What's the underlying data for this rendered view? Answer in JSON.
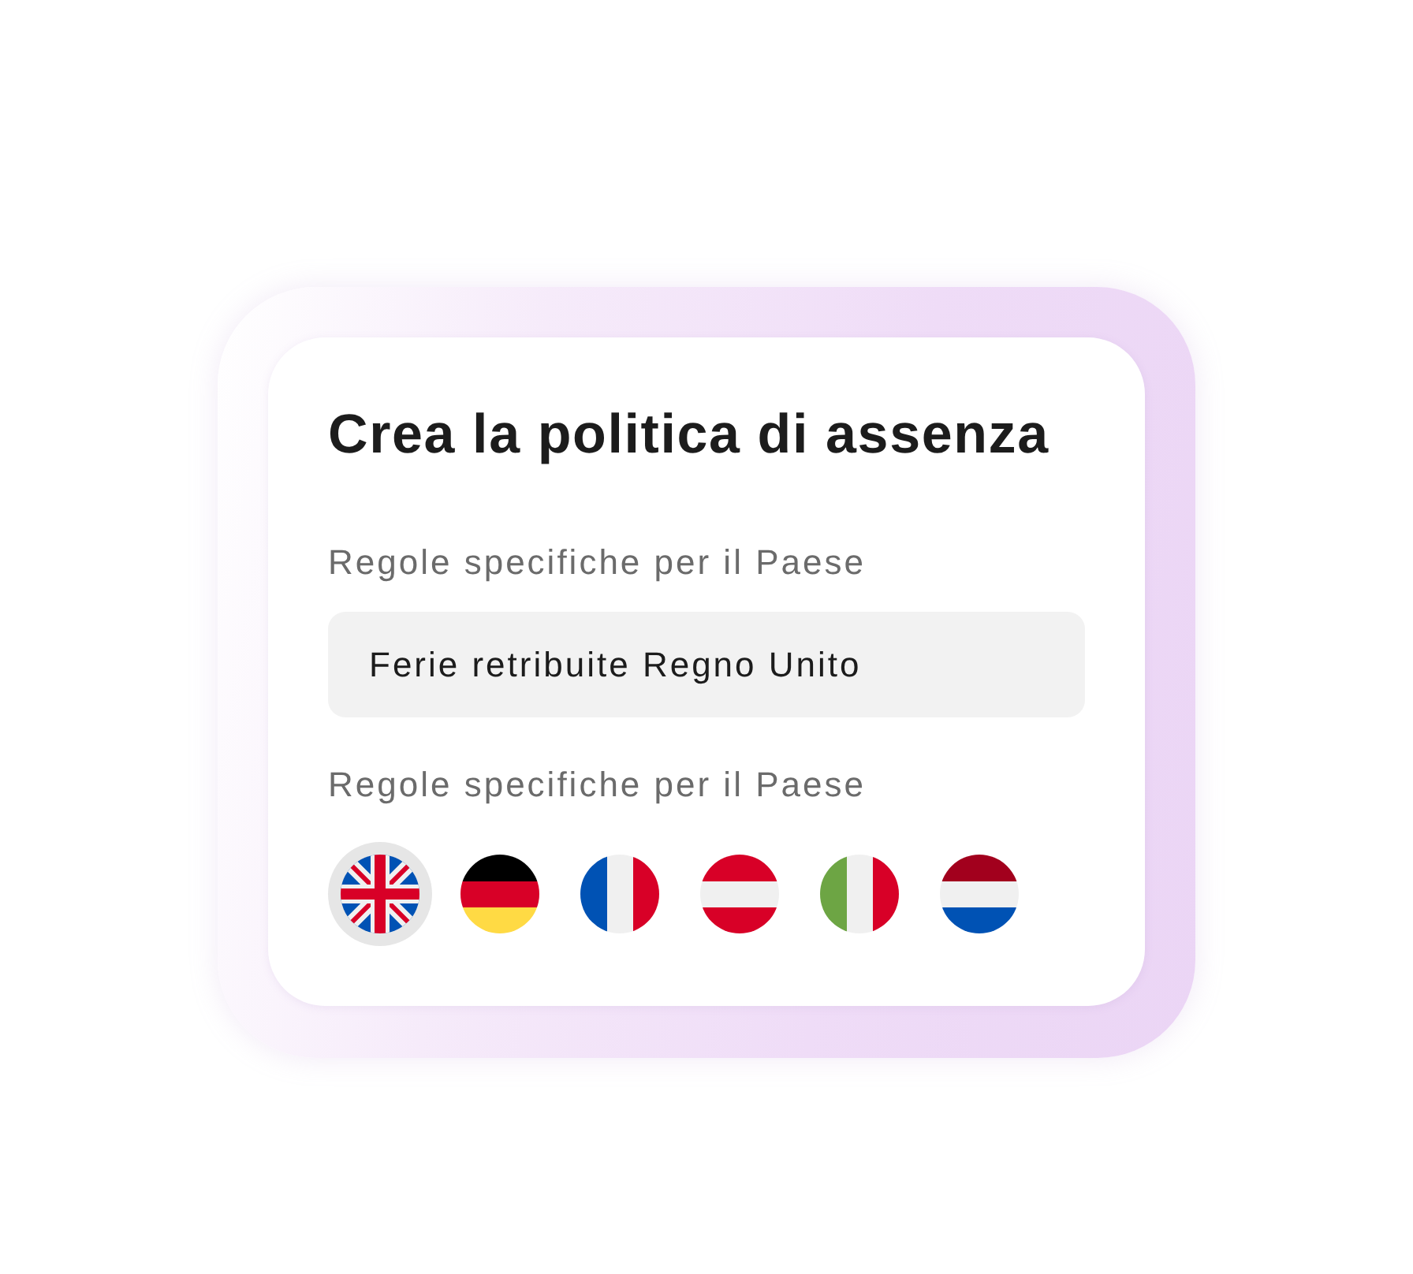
{
  "card": {
    "title": "Crea la politica di assenza"
  },
  "policy_field": {
    "label": "Regole specifiche per il Paese",
    "value": "Ferie retribuite Regno Unito"
  },
  "countries": {
    "label": "Regole specifiche per il Paese",
    "flags": [
      {
        "kind": "uk",
        "selected": true
      },
      {
        "kind": "de",
        "selected": false
      },
      {
        "kind": "fr",
        "selected": false
      },
      {
        "kind": "at",
        "selected": false
      },
      {
        "kind": "it",
        "selected": false
      },
      {
        "kind": "nl",
        "selected": false
      }
    ]
  }
}
